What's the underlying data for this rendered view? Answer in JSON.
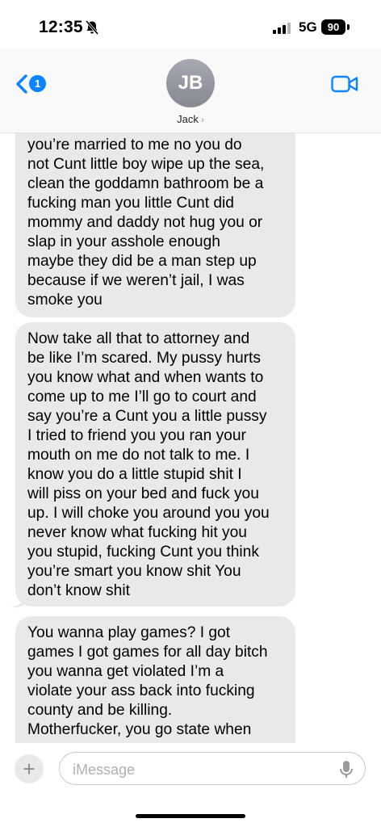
{
  "status_bar": {
    "time": "12:35",
    "network": "5G",
    "battery": "90"
  },
  "header": {
    "back_badge": "1",
    "avatar_initials": "JB",
    "contact_name": "Jack",
    "contact_chevron": "›"
  },
  "messages": [
    {
      "text": "understand me, so you think\nyou’re married to me no you do\nnot Cunt little boy wipe up the sea,\nclean the goddamn bathroom be a\nfucking man you little Cunt did\nmommy and daddy not hug you or\nslap in your asshole enough\nmaybe they did be a man step up\nbecause if we weren’t jail, I was\nsmoke you"
    },
    {
      "text": "Now take all that to attorney and\nbe like I’m scared. My pussy hurts\nyou know what and when wants to\ncome up to me I’ll go to court and\nsay you’re a Cunt you a little pussy\nI tried to friend you you ran your\nmouth on me do not talk to me. I\nknow you do a little stupid shit I\nwill piss on your bed and fuck you\nup. I will choke you around you you\nnever know what fucking hit you\nyou stupid, fucking Cunt you think\nyou’re smart you know shit You\ndon’t know shit"
    },
    {
      "text": "You wanna play games? I got\ngames I got games for all day bitch\nyou wanna get violated I’m a\nviolate your ass back into fucking\ncounty and be killing.\nMotherfucker, you go state when"
    }
  ],
  "composer": {
    "placeholder": "iMessage",
    "plus_label": "+"
  },
  "colors": {
    "accent": "#0a84ff",
    "bubble_gray": "#e9e9eb"
  }
}
